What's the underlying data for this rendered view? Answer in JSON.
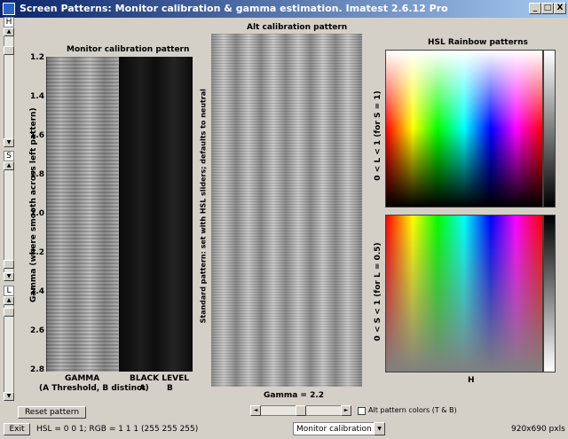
{
  "window": {
    "title": "Screen Patterns: Monitor calibration & gamma estimation.  Imatest 2.6.12  Pro",
    "min": "_",
    "max": "□",
    "close": "X"
  },
  "left_sliders": {
    "h_label": "H",
    "s_label": "S",
    "l_label": "L",
    "up": "▲",
    "down": "▼",
    "h_fill": 0.0,
    "s_fill": 0.35,
    "l_fill": 0.0
  },
  "monitor_pattern": {
    "title": "Monitor calibration pattern",
    "ylabel": "Gamma (where smooth across left pattern)",
    "ticks": [
      "1.2",
      "1.4",
      "1.6",
      "1.8",
      "2.0",
      "2.2",
      "2.4",
      "2.6",
      "2.8"
    ],
    "gamma_label": "GAMMA",
    "gamma_sub": "(A Threshold, B distinct)",
    "black_label": "BLACK LEVEL",
    "black_a": "A",
    "black_b": "B"
  },
  "alt_pattern": {
    "title": "Alt calibration pattern",
    "side_label": "Standard pattern:  set with HSL sliders;  defaults to neutral",
    "gamma_value": "Gamma = 2.2",
    "slider_value": 0.5
  },
  "hsl": {
    "title": "HSL Rainbow patterns",
    "top_label": "0 < L < 1  (for S = 1)",
    "bottom_label": "0 < S < 1  (for L = 0.5)",
    "xlabel": "H"
  },
  "controls": {
    "reset_label": "Reset pattern",
    "exit_label": "Exit",
    "alt_colors_label": "Alt pattern colors (T & B)",
    "alt_colors_checked": false,
    "hsl_status": "HSL = 0   0   1;    RGB = 1        1        1     (255     255     255)",
    "mode_value": "Monitor calibration",
    "size_text": "920x690 pxls"
  }
}
